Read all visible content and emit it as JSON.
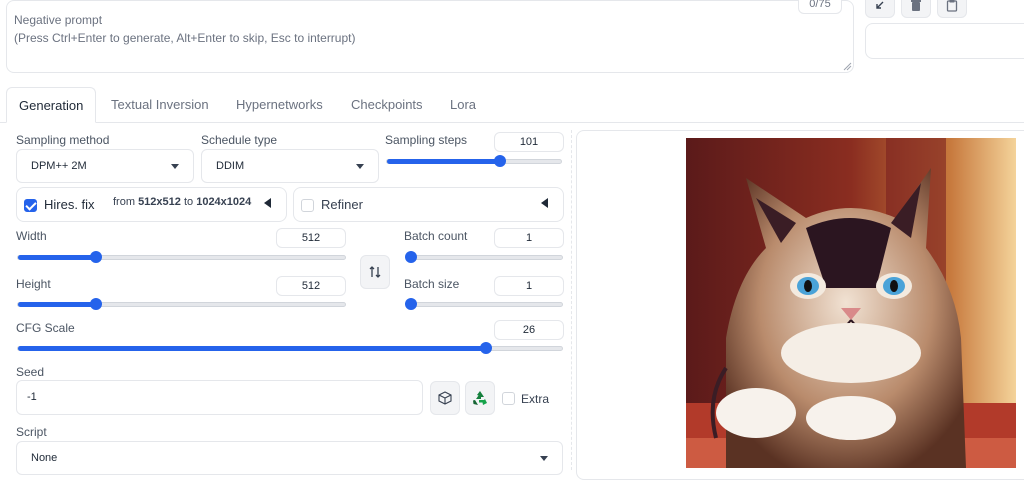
{
  "negative_prompt": {
    "label": "Negative prompt",
    "hint": "(Press Ctrl+Enter to generate, Alt+Enter to skip, Esc to interrupt)",
    "token_counter": "0/75"
  },
  "toolbar_icons": [
    "arrow-icon",
    "trash-icon",
    "clipboard-icon"
  ],
  "tabs": [
    {
      "label": "Generation",
      "active": true
    },
    {
      "label": "Textual Inversion",
      "active": false
    },
    {
      "label": "Hypernetworks",
      "active": false
    },
    {
      "label": "Checkpoints",
      "active": false
    },
    {
      "label": "Lora",
      "active": false
    }
  ],
  "sampling": {
    "method_label": "Sampling method",
    "method_value": "DPM++ 2M",
    "schedule_label": "Schedule type",
    "schedule_value": "DDIM",
    "steps_label": "Sampling steps",
    "steps_value": "101",
    "steps_fraction": 0.65
  },
  "hires": {
    "label": "Hires. fix",
    "checked": true,
    "from_prefix": "from",
    "from_value": "512x512",
    "to_prefix": "to",
    "to_value": "1024x1024"
  },
  "refiner": {
    "label": "Refiner",
    "checked": false
  },
  "width": {
    "label": "Width",
    "value": "512",
    "fraction": 0.24
  },
  "height": {
    "label": "Height",
    "value": "512",
    "fraction": 0.24
  },
  "batch_count": {
    "label": "Batch count",
    "value": "1",
    "fraction": 0.0
  },
  "batch_size": {
    "label": "Batch size",
    "value": "1",
    "fraction": 0.0
  },
  "cfg": {
    "label": "CFG Scale",
    "value": "26",
    "fraction": 0.86
  },
  "seed": {
    "label": "Seed",
    "value": "-1",
    "extra_label": "Extra"
  },
  "script": {
    "label": "Script",
    "value": "None"
  },
  "colors": {
    "accent": "#2563eb",
    "border": "#e5e7eb",
    "muted_text": "#6b7280"
  }
}
